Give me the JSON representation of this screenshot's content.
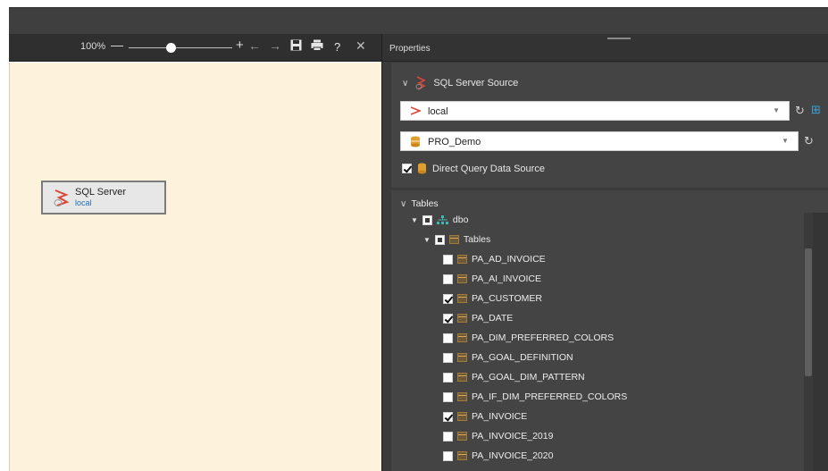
{
  "toolbar": {
    "zoom_label": "100%",
    "zoom_level_percent": 100,
    "minus": "—",
    "plus": "+",
    "undo": "←",
    "redo": "→",
    "save": "💾",
    "print": "🖶",
    "help": "?",
    "close": "✕"
  },
  "canvas": {
    "node": {
      "title": "SQL Server",
      "subtitle": "local",
      "icon": "sql-server-icon"
    }
  },
  "properties": {
    "title": "Properties",
    "source_section": {
      "title": "SQL Server Source",
      "server": {
        "value": "local",
        "icon": "server-icon"
      },
      "database": {
        "value": "PRO_Demo",
        "icon": "database-icon"
      },
      "direct_query": {
        "label": "Direct Query Data Source",
        "checked": true
      }
    },
    "tables_section": {
      "title": "Tables",
      "schema": "dbo",
      "folder": "Tables",
      "items": [
        {
          "name": "PA_AD_INVOICE",
          "checked": false
        },
        {
          "name": "PA_AI_INVOICE",
          "checked": false
        },
        {
          "name": "PA_CUSTOMER",
          "checked": true
        },
        {
          "name": "PA_DATE",
          "checked": true
        },
        {
          "name": "PA_DIM_PREFERRED_COLORS",
          "checked": false
        },
        {
          "name": "PA_GOAL_DEFINITION",
          "checked": false
        },
        {
          "name": "PA_GOAL_DIM_PATTERN",
          "checked": false
        },
        {
          "name": "PA_IF_DIM_PREFERRED_COLORS",
          "checked": false
        },
        {
          "name": "PA_INVOICE",
          "checked": true
        },
        {
          "name": "PA_INVOICE_2019",
          "checked": false
        },
        {
          "name": "PA_INVOICE_2020",
          "checked": false
        }
      ]
    }
  },
  "colors": {
    "canvas_bg": "#fdf3dc",
    "panel_bg": "#444444",
    "toolbar_bg": "#2f2f2f",
    "accent_red": "#d9463a",
    "accent_orange": "#e0a030"
  }
}
